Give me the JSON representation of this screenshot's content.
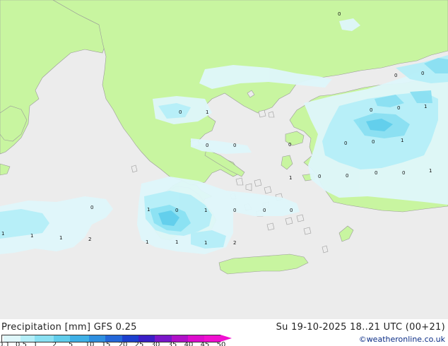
{
  "title": "Precipitation [mm]  GFS 0.25",
  "valid_time": "Su 19-10-2025 18..21 UTC (00+21)",
  "credit": "©weatheronline.co.uk",
  "colors": {
    "sea": "#ececec",
    "land": "#c8f5a0",
    "border": "#9a9a9a"
  },
  "legend": {
    "swatches": [
      {
        "color": "#ffffff"
      },
      {
        "color": "#dff7fb"
      },
      {
        "color": "#b4eef8"
      },
      {
        "color": "#8ae0f2"
      },
      {
        "color": "#61cdeb"
      },
      {
        "color": "#3fb0e6"
      },
      {
        "color": "#2e8fe0"
      },
      {
        "color": "#2467d8"
      },
      {
        "color": "#1c3fce"
      },
      {
        "color": "#3a1ec6"
      },
      {
        "color": "#7a16c8"
      },
      {
        "color": "#b010c8"
      },
      {
        "color": "#dd0ccd"
      },
      {
        "color": "#f010d0"
      }
    ],
    "ticks": [
      "0.1",
      "0.5",
      "1",
      "2",
      "5",
      "10",
      "15",
      "20",
      "25",
      "30",
      "35",
      "40",
      "45",
      "50"
    ]
  },
  "map_values": [
    "0",
    "0",
    "0",
    "1",
    "0",
    "0",
    "0",
    "0",
    "0",
    "0",
    "0",
    "0",
    "0",
    "1",
    "1",
    "0",
    "1",
    "1",
    "0",
    "0",
    "1",
    "0",
    "1",
    "0",
    "0",
    "0",
    "1",
    "1",
    "1",
    "2",
    "1",
    "1",
    "1",
    "2",
    "0"
  ]
}
